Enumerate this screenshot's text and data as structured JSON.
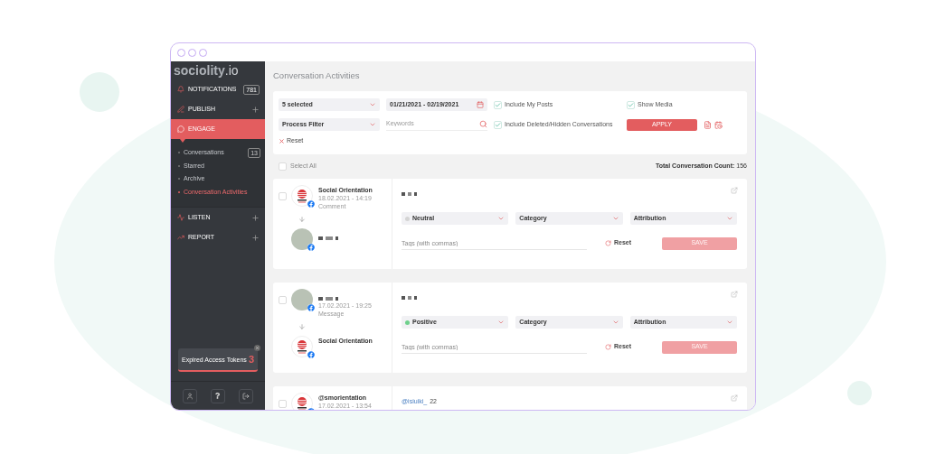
{
  "sidebar": {
    "logo": {
      "name": "sociolity",
      "suffix": ".io"
    },
    "items": [
      {
        "kind": "link",
        "label": "NOTIFICATIONS",
        "badge": "781",
        "selected": false
      },
      {
        "kind": "group",
        "label": "PUBLISH",
        "expanded": false,
        "selected": false
      },
      {
        "kind": "group",
        "label": "ENGAGE",
        "expanded": true,
        "selected": true,
        "children": [
          {
            "label": "Conversations",
            "badge": "13",
            "selected": false
          },
          {
            "label": "Starred",
            "selected": false
          },
          {
            "label": "Archive",
            "selected": false
          },
          {
            "label": "Conversation Activities",
            "selected": true
          }
        ]
      },
      {
        "kind": "group",
        "label": "LISTEN",
        "expanded": false,
        "selected": false
      },
      {
        "kind": "group",
        "label": "REPORT",
        "expanded": false,
        "selected": false
      }
    ],
    "token_alert": {
      "label": "Expired Access Tokens",
      "count": "3"
    }
  },
  "page": {
    "title": "Conversation Activities"
  },
  "filters": {
    "account_select": {
      "value": "5 selected"
    },
    "date_range": {
      "value": "01/21/2021 - 02/19/2021"
    },
    "process_filter": {
      "value": "Process Filter"
    },
    "keywords": {
      "placeholder": "Keywords"
    },
    "options": [
      {
        "label": "Include My Posts",
        "checked": true
      },
      {
        "label": "Show Media",
        "checked": true
      },
      {
        "label": "Include Deleted/Hidden Conversations",
        "checked": true
      }
    ],
    "apply_button": "APPLY",
    "reset": "Reset"
  },
  "list_header": {
    "select_all": {
      "label": "Select All",
      "checked": false
    },
    "total_label": "Total Conversation Count:",
    "total_value": "156"
  },
  "conversations": [
    {
      "checked": false,
      "participants": [
        {
          "kind": "brand",
          "name": "Social Orientation",
          "date": "18.02.2021 - 14:19",
          "type": "Comment"
        },
        {
          "kind": "person"
        }
      ],
      "message": {
        "kind": "redacted"
      },
      "sentiment": {
        "label": "Neutral",
        "color": "#d4d4d4"
      },
      "category": "Category",
      "attribution": "Attribution",
      "tags": {
        "placeholder": "Tags (with commas)"
      },
      "reset": "Reset",
      "save": {
        "label": "SAVE",
        "disabled": true
      }
    },
    {
      "checked": false,
      "participants": [
        {
          "kind": "person",
          "date": "17.02.2021 - 19:25",
          "type": "Message"
        },
        {
          "kind": "brand",
          "name": "Social Orientation"
        }
      ],
      "message": {
        "kind": "redacted"
      },
      "sentiment": {
        "label": "Positive",
        "color": "#6fd08c"
      },
      "category": "Category",
      "attribution": "Attribution",
      "tags": {
        "placeholder": "Tags (with commas)"
      },
      "reset": "Reset",
      "save": {
        "label": "SAVE",
        "disabled": true
      }
    },
    {
      "checked": false,
      "participants": [
        {
          "kind": "brand",
          "name": "@smorientation",
          "date": "17.02.2021 - 13:54"
        }
      ],
      "message": {
        "kind": "text",
        "mention": "@isiuiki_",
        "text": "22"
      }
    }
  ]
}
